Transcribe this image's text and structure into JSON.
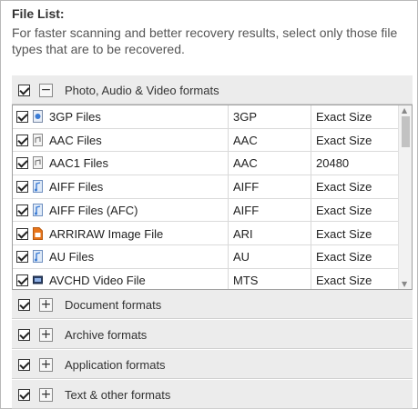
{
  "header": {
    "title": "File List:",
    "description": "For faster scanning and better recovery results, select only those file types that are to be recovered."
  },
  "groups": [
    {
      "label": "Photo, Audio & Video formats",
      "expander": "−",
      "checked": true
    },
    {
      "label": "Document formats",
      "expander": "+",
      "checked": true
    },
    {
      "label": "Archive formats",
      "expander": "+",
      "checked": true
    },
    {
      "label": "Application formats",
      "expander": "+",
      "checked": true
    },
    {
      "label": "Text & other formats",
      "expander": "+",
      "checked": true
    }
  ],
  "files": [
    {
      "name": "3GP Files",
      "ext": "3GP",
      "size": "Exact Size",
      "icon": "video-file-icon",
      "checked": true
    },
    {
      "name": "AAC Files",
      "ext": "AAC",
      "size": "Exact Size",
      "icon": "audio-file-icon",
      "checked": true
    },
    {
      "name": "AAC1 Files",
      "ext": "AAC",
      "size": "20480",
      "icon": "audio-file-icon",
      "checked": true
    },
    {
      "name": "AIFF Files",
      "ext": "AIFF",
      "size": "Exact Size",
      "icon": "music-file-icon",
      "checked": true
    },
    {
      "name": "AIFF Files (AFC)",
      "ext": "AIFF",
      "size": "Exact Size",
      "icon": "music-file-icon",
      "checked": true
    },
    {
      "name": "ARRIRAW Image File",
      "ext": "ARI",
      "size": "Exact Size",
      "icon": "image-file-icon",
      "checked": true
    },
    {
      "name": "AU Files",
      "ext": "AU",
      "size": "Exact Size",
      "icon": "music-file-icon",
      "checked": true
    },
    {
      "name": "AVCHD Video File",
      "ext": "MTS",
      "size": "Exact Size",
      "icon": "video-file-icon",
      "checked": true
    }
  ],
  "colors": {
    "group_bg": "#ececec",
    "accent_orange": "#e8751a",
    "icon_blue": "#3a7bd5"
  }
}
